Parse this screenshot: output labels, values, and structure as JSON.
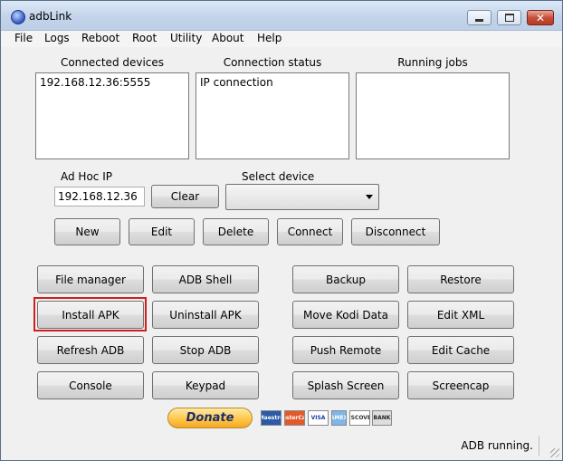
{
  "window": {
    "title": "adbLink",
    "close_glyph": "✕"
  },
  "menu": [
    "File",
    "Logs",
    "Reboot",
    "Root",
    "Utility",
    "About",
    "Help"
  ],
  "panels": {
    "connected_devices": {
      "label": "Connected devices",
      "items": [
        "192.168.12.36:5555"
      ]
    },
    "connection_status": {
      "label": "Connection status",
      "items": [
        "IP connection"
      ]
    },
    "running_jobs": {
      "label": "Running jobs",
      "items": []
    }
  },
  "adhoc": {
    "label": "Ad Hoc IP",
    "value": "192.168.12.36",
    "clear_label": "Clear"
  },
  "select_device": {
    "label": "Select device",
    "value": ""
  },
  "device_buttons": {
    "new": "New",
    "edit": "Edit",
    "delete": "Delete",
    "connect": "Connect",
    "disconnect": "Disconnect"
  },
  "actions": {
    "file_manager": "File manager",
    "adb_shell": "ADB Shell",
    "backup": "Backup",
    "restore": "Restore",
    "install_apk": "Install APK",
    "uninstall_apk": "Uninstall APK",
    "move_kodi_data": "Move Kodi Data",
    "edit_xml": "Edit XML",
    "refresh_adb": "Refresh ADB",
    "stop_adb": "Stop ADB",
    "push_remote": "Push Remote",
    "edit_cache": "Edit Cache",
    "console": "Console",
    "keypad": "Keypad",
    "splash_screen": "Splash Screen",
    "screencap": "Screencap"
  },
  "donate": {
    "label": "Donate",
    "cards": [
      "Maestro",
      "MasterCard",
      "VISA",
      "AMEX",
      "DISCOVER",
      "BANK"
    ]
  },
  "colors": {
    "highlight": "#cc1f1f",
    "donate": "#ffc84a"
  },
  "status": "ADB running."
}
